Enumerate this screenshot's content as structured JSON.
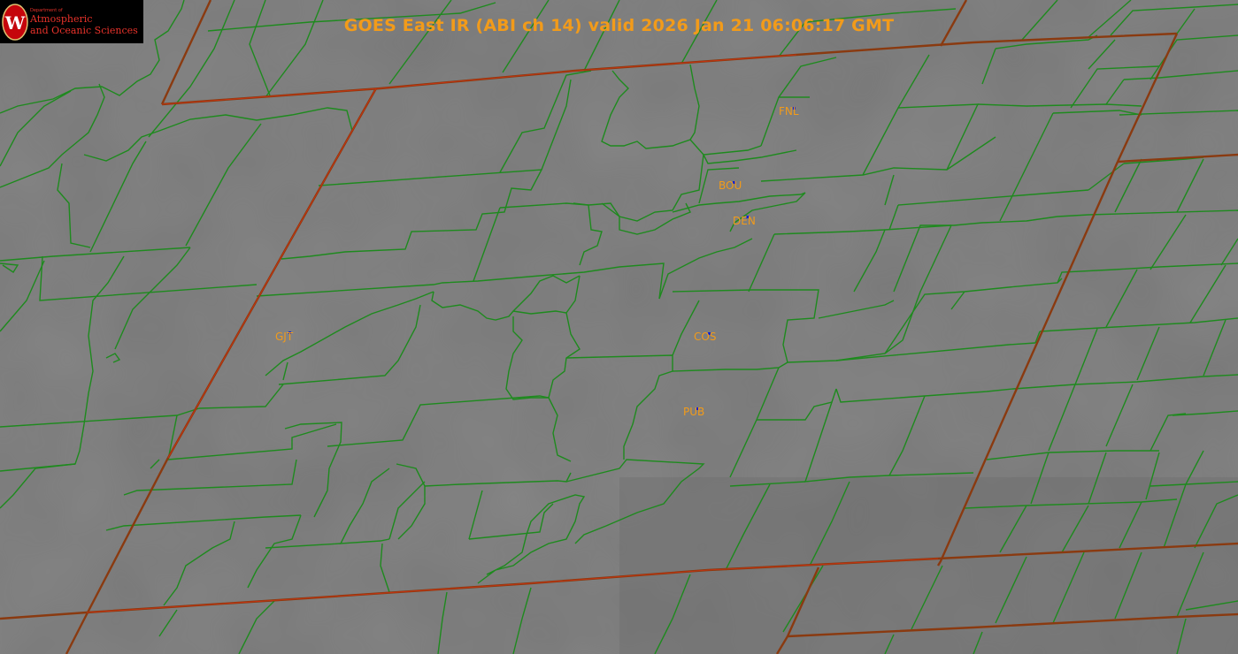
{
  "title": "GOES East IR (ABI ch 14) valid 2026 Jan 21 06:06:17 GMT",
  "logo": {
    "department": "Department of",
    "line1": "Atmospheric",
    "line2": "and Oceanic Sciences",
    "emblem_letter": "W"
  },
  "stations": [
    {
      "id": "fnl",
      "label": "FNL"
    },
    {
      "id": "bou",
      "label": "BOU"
    },
    {
      "id": "den",
      "label": "DEN"
    },
    {
      "id": "gjt",
      "label": "GJT"
    },
    {
      "id": "cos",
      "label": "COS"
    },
    {
      "id": "pub",
      "label": "PUB"
    }
  ],
  "colors": {
    "background": "#777777",
    "county_lines": "#1e8a1e",
    "state_lines": "#8a3a10",
    "station_labels": "#f29b1a",
    "station_markers": "#0a1fd6",
    "title": "#f29b1a"
  }
}
